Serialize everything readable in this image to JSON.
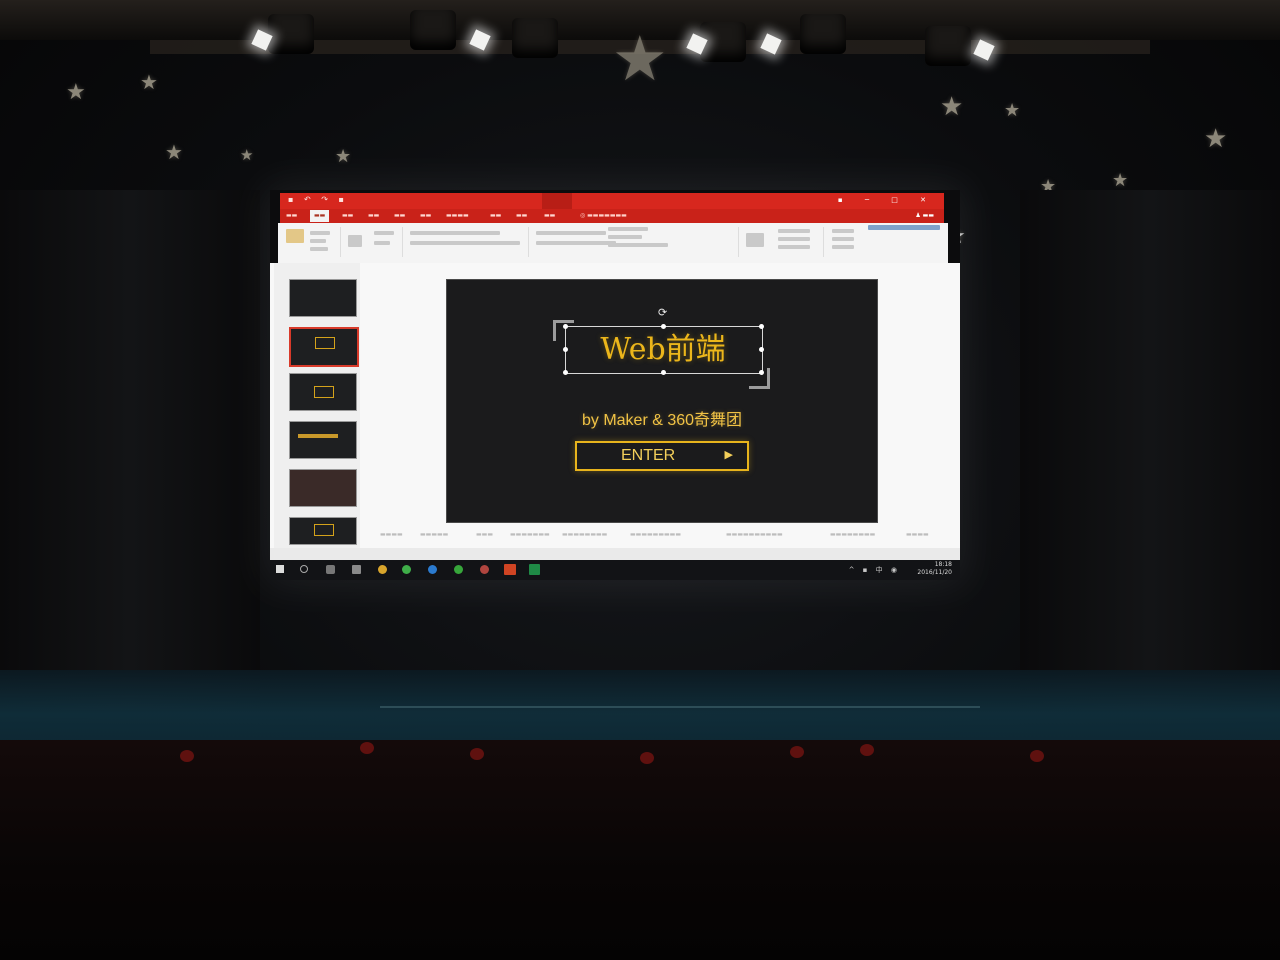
{
  "scene": {
    "description_free": true,
    "colors": {
      "accent_gold": "#ecb61b",
      "ppt_red": "#d7271e",
      "slide_bg": "#1b1b1c"
    }
  },
  "powerpoint": {
    "slide": {
      "title": "Web前端",
      "subtitle": "by Maker & 360奇舞团",
      "button_label": "ENTER",
      "button_icon": "play-triangle-icon"
    },
    "taskbar": {
      "time": "18:18",
      "date": "2016/11/20"
    }
  }
}
